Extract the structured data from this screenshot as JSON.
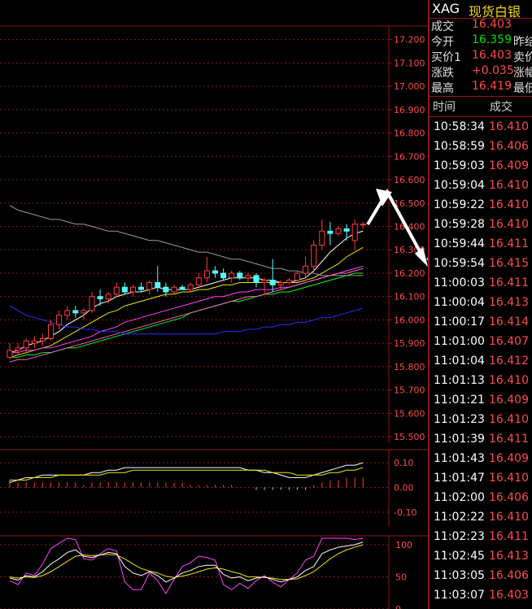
{
  "header": {
    "symbol": "XAG",
    "name": "现货白银"
  },
  "quote": [
    {
      "label": "成交",
      "value": "16.403",
      "color": "#ff4b4b",
      "extra": ""
    },
    {
      "label": "今开",
      "value": "16.359",
      "color": "#00e000",
      "extra": "昨结"
    },
    {
      "label": "买价1",
      "value": "16.403",
      "color": "#ff4b4b",
      "extra": "卖价"
    },
    {
      "label": "涨跌",
      "value": "+0.035",
      "color": "#ff4b4b",
      "extra": "涨幅"
    },
    {
      "label": "最高",
      "value": "16.419",
      "color": "#ff4b4b",
      "extra": "最低"
    }
  ],
  "ticks_header": {
    "time": "时间",
    "price": "成交"
  },
  "ticks": [
    {
      "time": "10:58:34",
      "price": "16.410"
    },
    {
      "time": "10:58:59",
      "price": "16.406"
    },
    {
      "time": "10:59:03",
      "price": "16.409"
    },
    {
      "time": "10:59:04",
      "price": "16.410"
    },
    {
      "time": "10:59:22",
      "price": "16.410"
    },
    {
      "time": "10:59:28",
      "price": "16.410"
    },
    {
      "time": "10:59:44",
      "price": "16.411"
    },
    {
      "time": "10:59:54",
      "price": "16.415"
    },
    {
      "time": "11:00:03",
      "price": "16.411"
    },
    {
      "time": "11:00:04",
      "price": "16.413"
    },
    {
      "time": "11:00:17",
      "price": "16.414"
    },
    {
      "time": "11:01:00",
      "price": "16.407"
    },
    {
      "time": "11:01:04",
      "price": "16.412"
    },
    {
      "time": "11:01:13",
      "price": "16.410"
    },
    {
      "time": "11:01:21",
      "price": "16.409"
    },
    {
      "time": "11:01:23",
      "price": "16.410"
    },
    {
      "time": "11:01:39",
      "price": "16.411"
    },
    {
      "time": "11:01:43",
      "price": "16.409"
    },
    {
      "time": "11:01:47",
      "price": "16.410"
    },
    {
      "time": "11:02:00",
      "price": "16.406"
    },
    {
      "time": "11:02:22",
      "price": "16.410"
    },
    {
      "time": "11:02:23",
      "price": "16.411"
    },
    {
      "time": "11:02:45",
      "price": "16.413"
    },
    {
      "time": "11:03:05",
      "price": "16.406"
    },
    {
      "time": "11:03:07",
      "price": "16.403"
    }
  ],
  "chart_data": {
    "type": "line",
    "title": "",
    "price_panel": {
      "y_ticks": [
        "17.200",
        "17.100",
        "17.000",
        "16.900",
        "16.800",
        "16.700",
        "16.600",
        "16.500",
        "16.400",
        "16.300",
        "16.200",
        "16.100",
        "16.000",
        "15.900",
        "15.800",
        "15.700",
        "15.600",
        "15.500"
      ],
      "ylim": [
        15.49,
        17.23
      ],
      "candles": [
        {
          "o": 15.84,
          "h": 15.9,
          "l": 15.83,
          "c": 15.87
        },
        {
          "o": 15.87,
          "h": 15.9,
          "l": 15.85,
          "c": 15.88
        },
        {
          "o": 15.88,
          "h": 15.92,
          "l": 15.86,
          "c": 15.91
        },
        {
          "o": 15.9,
          "h": 15.93,
          "l": 15.88,
          "c": 15.91
        },
        {
          "o": 15.91,
          "h": 15.94,
          "l": 15.89,
          "c": 15.92
        },
        {
          "o": 15.92,
          "h": 16.0,
          "l": 15.91,
          "c": 15.98
        },
        {
          "o": 15.98,
          "h": 16.04,
          "l": 15.96,
          "c": 16.02
        },
        {
          "o": 16.02,
          "h": 16.06,
          "l": 16.0,
          "c": 16.04
        },
        {
          "o": 16.04,
          "h": 16.06,
          "l": 16.01,
          "c": 16.03
        },
        {
          "o": 16.03,
          "h": 16.05,
          "l": 16.0,
          "c": 16.04
        },
        {
          "o": 16.04,
          "h": 16.12,
          "l": 16.03,
          "c": 16.1
        },
        {
          "o": 16.1,
          "h": 16.13,
          "l": 16.06,
          "c": 16.09
        },
        {
          "o": 16.09,
          "h": 16.12,
          "l": 16.07,
          "c": 16.11
        },
        {
          "o": 16.11,
          "h": 16.16,
          "l": 16.1,
          "c": 16.14
        },
        {
          "o": 16.14,
          "h": 16.16,
          "l": 16.11,
          "c": 16.12
        },
        {
          "o": 16.12,
          "h": 16.15,
          "l": 16.1,
          "c": 16.14
        },
        {
          "o": 16.14,
          "h": 16.16,
          "l": 16.12,
          "c": 16.13
        },
        {
          "o": 16.13,
          "h": 16.17,
          "l": 16.11,
          "c": 16.16
        },
        {
          "o": 16.16,
          "h": 16.23,
          "l": 16.12,
          "c": 16.14
        },
        {
          "o": 16.14,
          "h": 16.16,
          "l": 16.1,
          "c": 16.12
        },
        {
          "o": 16.12,
          "h": 16.15,
          "l": 16.11,
          "c": 16.14
        },
        {
          "o": 16.14,
          "h": 16.15,
          "l": 16.13,
          "c": 16.13
        },
        {
          "o": 16.13,
          "h": 16.16,
          "l": 16.12,
          "c": 16.15
        },
        {
          "o": 16.15,
          "h": 16.2,
          "l": 16.14,
          "c": 16.18
        },
        {
          "o": 16.18,
          "h": 16.27,
          "l": 16.16,
          "c": 16.21
        },
        {
          "o": 16.21,
          "h": 16.23,
          "l": 16.18,
          "c": 16.2
        },
        {
          "o": 16.2,
          "h": 16.22,
          "l": 16.17,
          "c": 16.18
        },
        {
          "o": 16.18,
          "h": 16.21,
          "l": 16.16,
          "c": 16.2
        },
        {
          "o": 16.2,
          "h": 16.21,
          "l": 16.17,
          "c": 16.18
        },
        {
          "o": 16.18,
          "h": 16.2,
          "l": 16.16,
          "c": 16.19
        },
        {
          "o": 16.19,
          "h": 16.2,
          "l": 16.14,
          "c": 16.16
        },
        {
          "o": 16.16,
          "h": 16.18,
          "l": 16.11,
          "c": 16.17
        },
        {
          "o": 16.17,
          "h": 16.26,
          "l": 16.12,
          "c": 16.15
        },
        {
          "o": 16.15,
          "h": 16.17,
          "l": 16.13,
          "c": 16.16
        },
        {
          "o": 16.16,
          "h": 16.18,
          "l": 16.15,
          "c": 16.17
        },
        {
          "o": 16.17,
          "h": 16.21,
          "l": 16.16,
          "c": 16.2
        },
        {
          "o": 16.2,
          "h": 16.27,
          "l": 16.18,
          "c": 16.23
        },
        {
          "o": 16.23,
          "h": 16.34,
          "l": 16.21,
          "c": 16.32
        },
        {
          "o": 16.32,
          "h": 16.43,
          "l": 16.3,
          "c": 16.38
        },
        {
          "o": 16.38,
          "h": 16.42,
          "l": 16.32,
          "c": 16.37
        },
        {
          "o": 16.37,
          "h": 16.4,
          "l": 16.36,
          "c": 16.39
        },
        {
          "o": 16.39,
          "h": 16.41,
          "l": 16.34,
          "c": 16.38
        },
        {
          "o": 16.34,
          "h": 16.43,
          "l": 16.3,
          "c": 16.41
        },
        {
          "o": 16.41,
          "h": 16.42,
          "l": 16.39,
          "c": 16.41
        }
      ],
      "moving_averages": [
        {
          "color": "#ffffff",
          "values": [
            15.86,
            15.87,
            15.89,
            15.9,
            15.91,
            15.93,
            15.95,
            15.98,
            16.0,
            16.02,
            16.05,
            16.07,
            16.08,
            16.1,
            16.11,
            16.12,
            16.12,
            16.13,
            16.14,
            16.13,
            16.13,
            16.13,
            16.13,
            16.14,
            16.15,
            16.16,
            16.17,
            16.18,
            16.18,
            16.18,
            16.18,
            16.17,
            16.17,
            16.16,
            16.16,
            16.17,
            16.18,
            16.21,
            16.25,
            16.29,
            16.32,
            16.35,
            16.37,
            16.38
          ]
        },
        {
          "color": "#f2e600",
          "values": [
            15.84,
            15.85,
            15.86,
            15.87,
            15.88,
            15.89,
            15.91,
            15.93,
            15.95,
            15.97,
            15.99,
            16.01,
            16.03,
            16.04,
            16.06,
            16.07,
            16.08,
            16.09,
            16.1,
            16.11,
            16.11,
            16.12,
            16.12,
            16.13,
            16.13,
            16.14,
            16.15,
            16.15,
            16.16,
            16.16,
            16.16,
            16.16,
            16.16,
            16.16,
            16.16,
            16.16,
            16.17,
            16.18,
            16.2,
            16.22,
            16.24,
            16.27,
            16.29,
            16.31
          ]
        },
        {
          "color": "#ff44ff",
          "values": [
            15.86,
            15.86,
            15.87,
            15.87,
            15.88,
            15.88,
            15.89,
            15.9,
            15.91,
            15.92,
            15.93,
            15.95,
            15.96,
            15.97,
            15.99,
            16.0,
            16.01,
            16.02,
            16.03,
            16.04,
            16.05,
            16.06,
            16.07,
            16.08,
            16.09,
            16.1,
            16.1,
            16.11,
            16.12,
            16.12,
            16.13,
            16.13,
            16.13,
            16.14,
            16.14,
            16.15,
            16.16,
            16.17,
            16.18,
            16.19,
            16.2,
            16.21,
            16.22,
            16.23
          ]
        },
        {
          "color": "#00ff00",
          "values": [
            15.84,
            15.84,
            15.85,
            15.85,
            15.86,
            15.86,
            15.87,
            15.88,
            15.88,
            15.89,
            15.9,
            15.91,
            15.92,
            15.93,
            15.94,
            15.95,
            15.96,
            15.97,
            15.98,
            15.99,
            16.0,
            16.01,
            16.03,
            16.04,
            16.05,
            16.06,
            16.07,
            16.08,
            16.08,
            16.09,
            16.1,
            16.11,
            16.11,
            16.12,
            16.12,
            16.13,
            16.14,
            16.15,
            16.16,
            16.17,
            16.18,
            16.19,
            16.2,
            16.2
          ]
        },
        {
          "color": "#ff66cc",
          "values": [
            15.82,
            15.83,
            15.83,
            15.84,
            15.85,
            15.86,
            15.87,
            15.88,
            15.89,
            15.9,
            15.91,
            15.92,
            15.93,
            15.94,
            15.95,
            15.96,
            15.97,
            15.98,
            15.99,
            16.0,
            16.01,
            16.02,
            16.03,
            16.04,
            16.05,
            16.06,
            16.07,
            16.08,
            16.09,
            16.1,
            16.1,
            16.11,
            16.12,
            16.13,
            16.14,
            16.15,
            16.16,
            16.17,
            16.18,
            16.19,
            16.2,
            16.2,
            16.21,
            16.22
          ]
        },
        {
          "color": "#2d2dff",
          "values": [
            16.06,
            16.04,
            16.02,
            16.01,
            16.0,
            15.99,
            15.98,
            15.97,
            15.97,
            15.96,
            15.96,
            15.95,
            15.95,
            15.95,
            15.94,
            15.94,
            15.94,
            15.94,
            15.94,
            15.94,
            15.94,
            15.94,
            15.94,
            15.94,
            15.94,
            15.94,
            15.95,
            15.95,
            15.95,
            15.96,
            15.96,
            15.97,
            15.97,
            15.98,
            15.98,
            15.99,
            15.99,
            16.0,
            16.01,
            16.01,
            16.02,
            16.03,
            16.04,
            16.05
          ]
        },
        {
          "color": "#9a9a9a",
          "values": [
            16.49,
            16.47,
            16.46,
            16.45,
            16.44,
            16.43,
            16.43,
            16.42,
            16.41,
            16.41,
            16.4,
            16.39,
            16.38,
            16.38,
            16.37,
            16.36,
            16.35,
            16.34,
            16.34,
            16.33,
            16.32,
            16.31,
            16.3,
            16.29,
            16.29,
            16.28,
            16.27,
            16.26,
            16.26,
            16.25,
            16.24,
            16.23,
            16.22,
            16.22,
            16.21,
            16.21,
            16.2,
            16.2,
            16.19,
            16.19,
            16.19,
            16.19,
            16.19,
            16.19
          ]
        }
      ]
    },
    "macd_panel": {
      "y_ticks": [
        "0.10",
        "0.00",
        "-0.10"
      ],
      "ylim": [
        -0.15,
        0.13
      ],
      "dif": [
        0.02,
        0.03,
        0.04,
        0.04,
        0.05,
        0.05,
        0.05,
        0.05,
        0.05,
        0.05,
        0.06,
        0.06,
        0.07,
        0.07,
        0.08,
        0.08,
        0.08,
        0.08,
        0.08,
        0.08,
        0.08,
        0.08,
        0.08,
        0.08,
        0.08,
        0.08,
        0.08,
        0.08,
        0.08,
        0.07,
        0.07,
        0.06,
        0.06,
        0.05,
        0.04,
        0.04,
        0.04,
        0.05,
        0.06,
        0.07,
        0.08,
        0.09,
        0.09,
        0.1
      ],
      "dea": [
        0.03,
        0.03,
        0.03,
        0.04,
        0.04,
        0.04,
        0.05,
        0.05,
        0.05,
        0.05,
        0.05,
        0.05,
        0.06,
        0.06,
        0.06,
        0.07,
        0.07,
        0.07,
        0.07,
        0.07,
        0.07,
        0.07,
        0.07,
        0.07,
        0.07,
        0.07,
        0.07,
        0.07,
        0.07,
        0.07,
        0.07,
        0.07,
        0.06,
        0.06,
        0.06,
        0.05,
        0.05,
        0.05,
        0.05,
        0.06,
        0.06,
        0.07,
        0.07,
        0.08
      ],
      "hist": [
        0.03,
        0.02,
        0.02,
        0.02,
        0.02,
        0.02,
        0.02,
        0.02,
        0.02,
        0.01,
        0.02,
        0.02,
        0.02,
        0.02,
        0.02,
        0.02,
        0.02,
        0.02,
        0.02,
        0.02,
        0.02,
        0.02,
        0.01,
        0.01,
        0.01,
        0.01,
        0.01,
        0.01,
        0.0,
        0.0,
        -0.01,
        -0.01,
        -0.01,
        -0.01,
        -0.01,
        -0.01,
        -0.01,
        0.01,
        0.02,
        0.03,
        0.03,
        0.04,
        0.04,
        0.04
      ]
    },
    "osc_panel": {
      "y_ticks": [
        "100",
        "50",
        "0"
      ],
      "ylim": [
        0,
        110
      ],
      "k": [
        48,
        45,
        52,
        50,
        58,
        70,
        78,
        88,
        92,
        82,
        80,
        84,
        88,
        86,
        66,
        56,
        52,
        58,
        52,
        42,
        48,
        56,
        60,
        66,
        68,
        68,
        54,
        48,
        50,
        44,
        48,
        50,
        46,
        42,
        46,
        50,
        60,
        66,
        86,
        92,
        96,
        98,
        100,
        104
      ],
      "d": [
        50,
        48,
        50,
        49,
        52,
        58,
        66,
        74,
        82,
        84,
        83,
        84,
        85,
        84,
        78,
        70,
        63,
        59,
        56,
        51,
        49,
        51,
        54,
        58,
        62,
        64,
        62,
        58,
        55,
        50,
        50,
        49,
        48,
        46,
        46,
        47,
        52,
        58,
        68,
        78,
        86,
        92,
        96,
        100
      ],
      "j": [
        44,
        38,
        56,
        52,
        70,
        94,
        102,
        112,
        108,
        78,
        76,
        86,
        94,
        90,
        42,
        30,
        30,
        56,
        44,
        24,
        46,
        66,
        72,
        82,
        80,
        76,
        38,
        30,
        40,
        32,
        44,
        52,
        42,
        34,
        46,
        56,
        76,
        82,
        122,
        120,
        116,
        112,
        108,
        112
      ]
    }
  }
}
